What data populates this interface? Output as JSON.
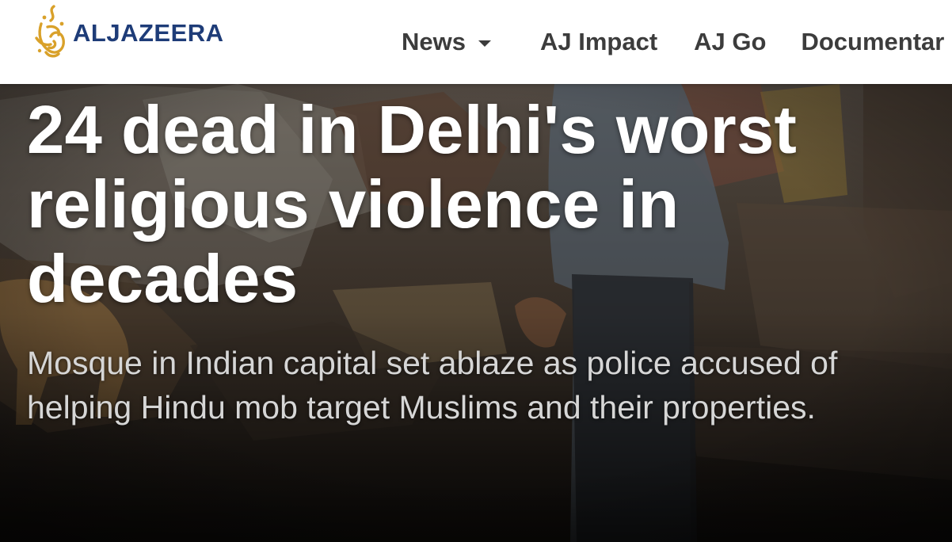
{
  "header": {
    "logo_text": "ALJAZEERA",
    "nav": [
      {
        "label": "News",
        "has_dropdown": true
      },
      {
        "label": "AJ Impact",
        "has_dropdown": false
      },
      {
        "label": "AJ Go",
        "has_dropdown": false
      },
      {
        "label": "Documentar",
        "has_dropdown": false
      }
    ]
  },
  "article": {
    "headline": "24 dead in Delhi's worst religious violence in decades",
    "standfirst": "Mosque in Indian capital set ablaze as police accused of helping Hindu mob target Muslims and their properties."
  },
  "colors": {
    "logo_gold": "#d9a12a",
    "logo_navy": "#1e3c78",
    "nav_text": "#3c3c3c",
    "headline": "#ffffff",
    "standfirst": "#d6d6d6"
  },
  "icons": {
    "logo_mark": "aljazeera-calligraphy-logo-icon",
    "nav_dropdown": "caret-down-icon"
  }
}
